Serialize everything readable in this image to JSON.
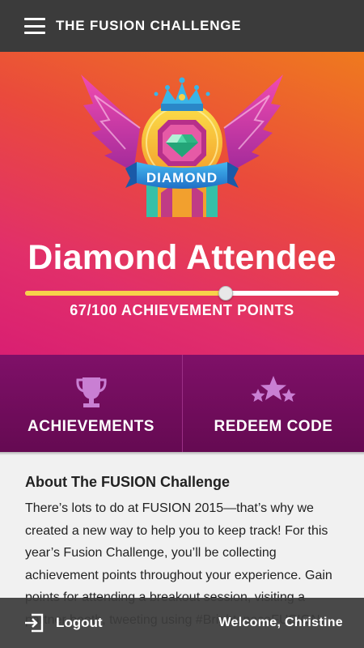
{
  "header": {
    "title": "THE FUSION CHALLENGE",
    "menu_icon": "hamburger-menu-icon"
  },
  "hero": {
    "badge_text": "DIAMOND",
    "level_title": "Diamond Attendee",
    "progress_fraction": 0.67,
    "points_text": "67/100 ACHIEVEMENT POINTS",
    "colors": {
      "gradient_top": "#ef7a1e",
      "gradient_bottom": "#d91f72",
      "progress": "#f7d24a"
    }
  },
  "actions": [
    {
      "label": "ACHIEVEMENTS",
      "icon": "trophy-icon"
    },
    {
      "label": "REDEEM CODE",
      "icon": "stars-icon"
    }
  ],
  "about": {
    "heading": "About The FUSION Challenge",
    "body": "There’s lots to do at FUSION 2015—that’s why we created a new way to help you to keep track! For this year’s Fusion Challenge, you’ll be collecting achievement points throughout your experience. Gain points for attending a breakout session, visiting a partner booth, tweeting using #BrightspaceFUSION,"
  },
  "footer": {
    "logout_label": "Logout",
    "welcome_text": "Welcome, Christine"
  }
}
